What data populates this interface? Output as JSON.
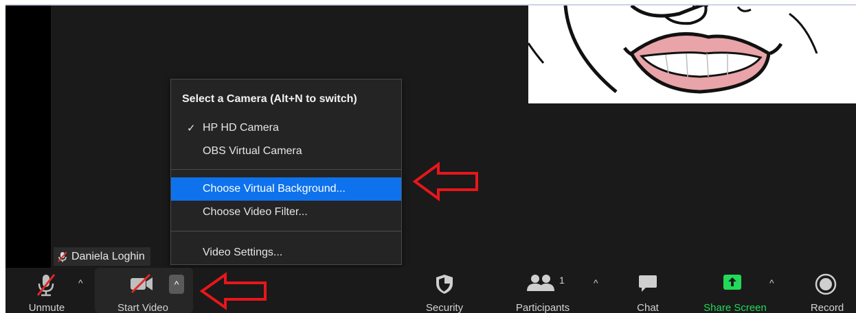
{
  "participant": {
    "name": "Daniela Loghin"
  },
  "camera_menu": {
    "title": "Select a Camera (Alt+N to switch)",
    "check_mark": "✓",
    "cameras": [
      {
        "label": "HP HD Camera",
        "selected": true
      },
      {
        "label": "OBS Virtual Camera",
        "selected": false
      }
    ],
    "actions": [
      {
        "label": "Choose Virtual Background...",
        "highlighted": true
      },
      {
        "label": "Choose Video Filter...",
        "highlighted": false
      }
    ],
    "settings_label": "Video Settings..."
  },
  "toolbar": {
    "unmute_label": "Unmute",
    "start_video_label": "Start Video",
    "security_label": "Security",
    "participants_label": "Participants",
    "participants_count": "1",
    "chat_label": "Chat",
    "share_screen_label": "Share Screen",
    "record_label": "Record",
    "caret": "^"
  },
  "colors": {
    "background": "#1a1a1a",
    "menu_background": "#242424",
    "highlight": "#0e72ed",
    "share_green": "#23d959",
    "muted_red": "#e02828",
    "annotation_red": "#e8161b"
  },
  "icons": {
    "muted_mic": "mic-off-icon",
    "video_off": "video-off-icon",
    "security": "shield-icon",
    "participants": "people-icon",
    "chat": "chat-bubble-icon",
    "share": "share-arrow-icon",
    "record": "record-icon",
    "annotation": "red-arrow-icon"
  }
}
